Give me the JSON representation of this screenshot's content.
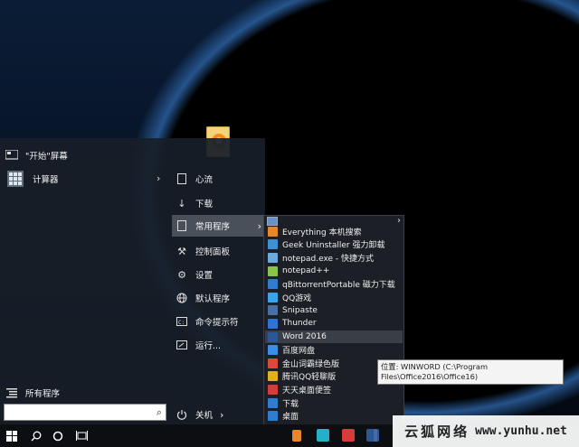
{
  "start_menu": {
    "left_items": [
      {
        "label": "\"开始\"屏幕",
        "icon": "start-screen-icon"
      },
      {
        "label": "计算器",
        "icon": "calculator-icon"
      }
    ],
    "all_programs": "所有程序",
    "right_items": [
      {
        "label": "心流",
        "icon": "document-icon"
      },
      {
        "label": "下载",
        "icon": "download-arrow-icon"
      },
      {
        "label": "常用程序",
        "icon": "folder-page-icon"
      },
      {
        "label": "控制面板",
        "icon": "wrench-icon"
      },
      {
        "label": "设置",
        "icon": "gear-icon"
      },
      {
        "label": "默认程序",
        "icon": "globe-icon"
      },
      {
        "label": "命令提示符",
        "icon": "terminal-icon"
      },
      {
        "label": "运行...",
        "icon": "run-icon"
      }
    ],
    "power": "关机"
  },
  "submenu": {
    "items": [
      {
        "label": "Everything 本机搜索",
        "color": "#e8862a"
      },
      {
        "label": "Geek Uninstaller 强力卸载",
        "color": "#3d8fd6"
      },
      {
        "label": "notepad.exe - 快捷方式",
        "color": "#6fa8dc"
      },
      {
        "label": "notepad++",
        "color": "#8bc34a"
      },
      {
        "label": "qBittorrentPortable 磁力下载",
        "color": "#2f7dd1"
      },
      {
        "label": "QQ游戏",
        "color": "#3ba4e8"
      },
      {
        "label": "Snipaste",
        "color": "#4a6fa5"
      },
      {
        "label": "Thunder",
        "color": "#2d74d6"
      },
      {
        "label": "Word 2016",
        "color": "#2b5797"
      },
      {
        "label": "百度网盘",
        "color": "#3a8ee6"
      },
      {
        "label": "金山词霸绿色版",
        "color": "#d94a3a"
      },
      {
        "label": "腾讯QQ轻聊版",
        "color": "#e0b020"
      },
      {
        "label": "天天桌面便签",
        "color": "#d93a3a"
      },
      {
        "label": "下载",
        "color": "#2f7dd1"
      },
      {
        "label": "桌面",
        "color": "#2f7dd1"
      }
    ]
  },
  "tooltip": {
    "text": "位置: WINWORD (C:\\Program Files\\Office2016\\Office16)"
  },
  "watermark": {
    "cn": "云狐网络",
    "url": "www.yunhu.net"
  }
}
